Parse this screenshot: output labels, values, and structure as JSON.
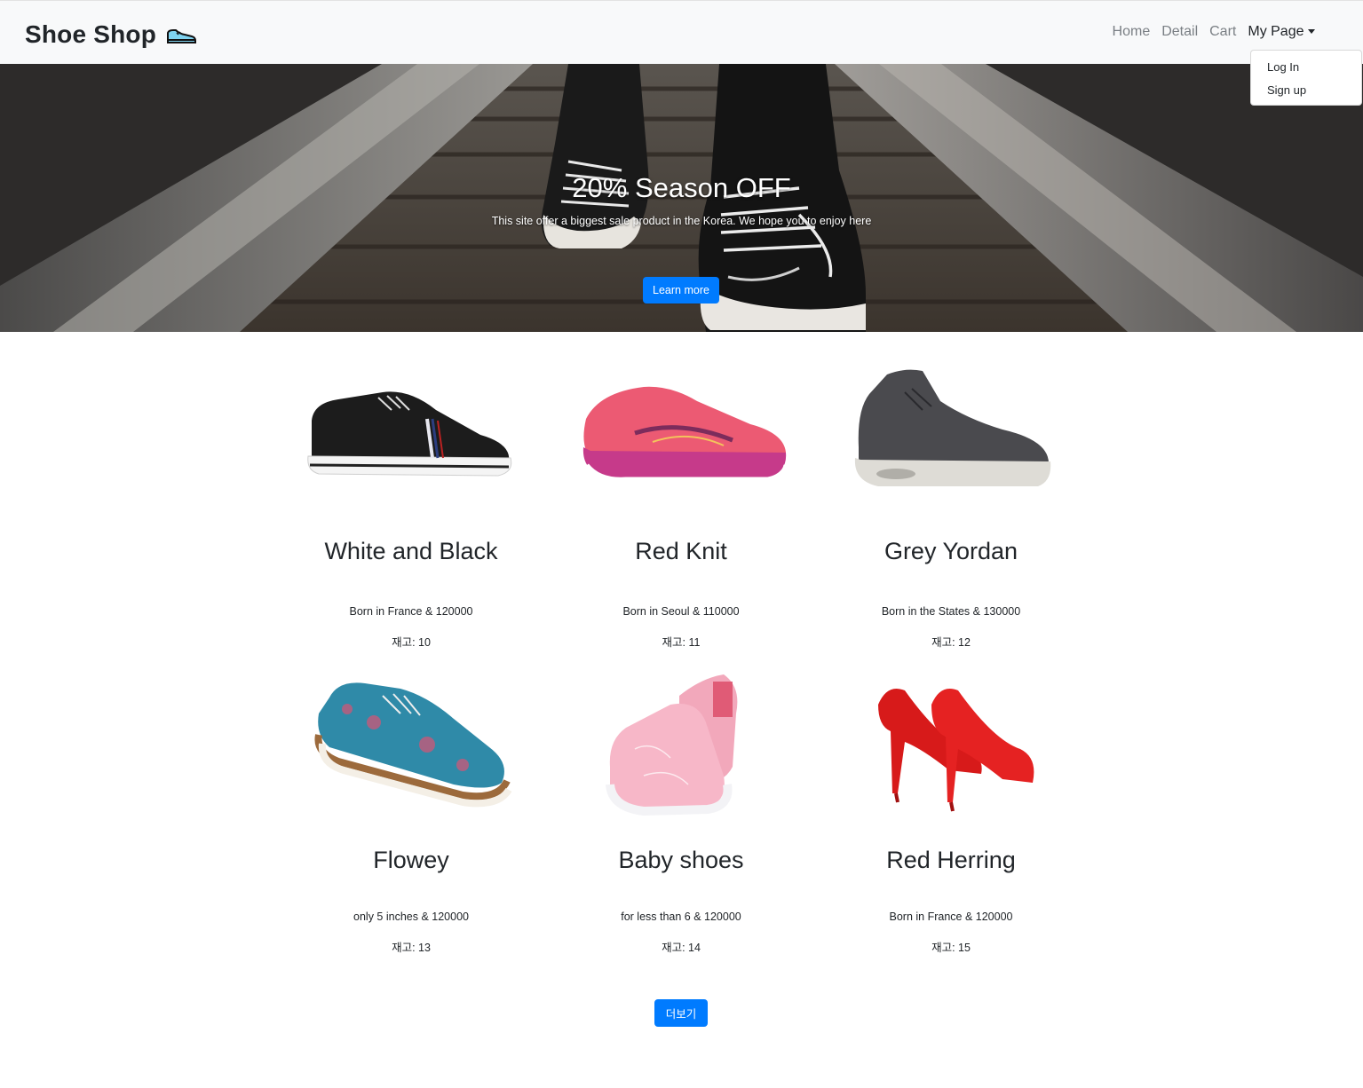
{
  "navbar": {
    "brand": "Shoe Shop",
    "brand_icon": "sneaker-icon",
    "links": [
      "Home",
      "Detail",
      "Cart"
    ],
    "mypage_label": "My Page",
    "dropdown": [
      "Log In",
      "Sign up"
    ]
  },
  "hero": {
    "title": "20% Season OFF",
    "subtitle": "This site offer a biggest sale product in the Korea. We hope you to enjoy here",
    "button": "Learn more"
  },
  "products": [
    {
      "name": "White and Black",
      "desc": "Born in France & 120000",
      "stock": "재고: 10"
    },
    {
      "name": "Red Knit",
      "desc": "Born in Seoul & 110000",
      "stock": "재고: 11"
    },
    {
      "name": "Grey Yordan",
      "desc": "Born in the States & 130000",
      "stock": "재고: 12"
    },
    {
      "name": "Flowey",
      "desc": "only 5 inches & 120000",
      "stock": "재고: 13"
    },
    {
      "name": "Baby shoes",
      "desc": "for less than 6 & 120000",
      "stock": "재고: 14"
    },
    {
      "name": "Red Herring",
      "desc": "Born in France & 120000",
      "stock": "재고: 15"
    }
  ],
  "more_button": "더보기",
  "colors": {
    "primary": "#007bff",
    "navbar_bg": "#f8f9fa"
  }
}
